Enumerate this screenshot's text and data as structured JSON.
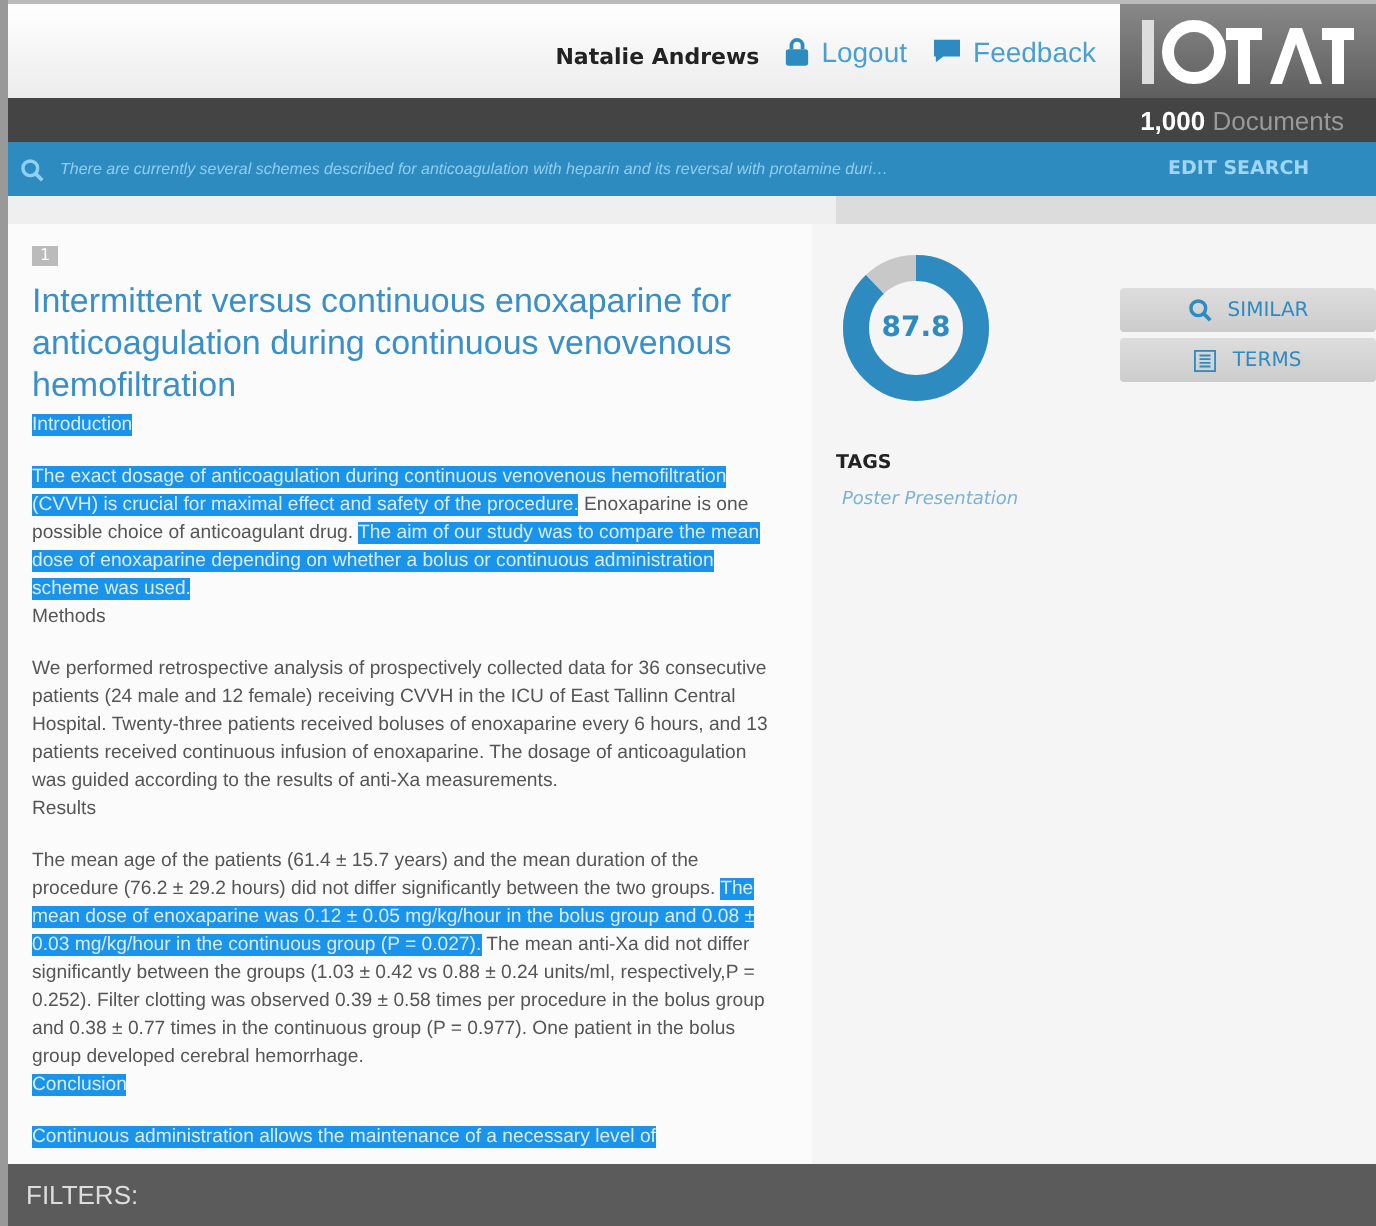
{
  "header": {
    "user": "Natalie Andrews",
    "logout": "Logout",
    "feedback": "Feedback"
  },
  "documents": {
    "count": "1,000",
    "label": "Documents"
  },
  "search": {
    "query": "There are currently several schemes described for anticoagulation with heparin and its reversal with protamine duri…",
    "edit": "EDIT SEARCH"
  },
  "result": {
    "number": "1",
    "title": "Intermittent versus continuous enoxaparine for anticoagulation during continuous venovenous hemofiltration",
    "blocks": [
      {
        "kind": "heading",
        "segments": [
          {
            "text": "Introduction",
            "highlighted": true
          }
        ]
      },
      {
        "kind": "paragraph",
        "segments": [
          {
            "text": "The exact dosage of anticoagulation during continuous venovenous hemofiltration (CVVH) is crucial for maximal effect and safety of the procedure.",
            "highlighted": true
          },
          {
            "text": " Enoxaparine is one possible choice of anticoagulant drug. ",
            "highlighted": false
          },
          {
            "text": "The aim of our study was to compare the mean dose of enoxaparine depending on whether a bolus or continuous administration scheme was used.",
            "highlighted": true
          }
        ]
      },
      {
        "kind": "heading",
        "segments": [
          {
            "text": "Methods",
            "highlighted": false
          }
        ]
      },
      {
        "kind": "paragraph",
        "segments": [
          {
            "text": "We performed retrospective analysis of prospectively collected data for 36 consecutive patients (24 male and 12 female) receiving CVVH in the ICU of East Tallinn Central Hospital. Twenty-three patients received boluses of enoxaparine every 6 hours, and 13 patients received continuous infusion of enoxaparine. The dosage of anticoagulation was guided according to the results of anti-Xa measurements.",
            "highlighted": false
          }
        ]
      },
      {
        "kind": "heading",
        "segments": [
          {
            "text": "Results",
            "highlighted": false
          }
        ]
      },
      {
        "kind": "paragraph",
        "segments": [
          {
            "text": "The mean age of the patients (61.4 ± 15.7 years) and the mean duration of the procedure (76.2 ± 29.2 hours) did not differ significantly between the two groups. ",
            "highlighted": false
          },
          {
            "text": "The mean dose of enoxaparine was 0.12 ± 0.05 mg/kg/hour in the bolus group and 0.08 ± 0.03 mg/kg/hour in the continuous group (P = 0.027).",
            "highlighted": true
          },
          {
            "text": " The mean anti-Xa did not differ significantly between the groups (1.03 ± 0.42 vs 0.88 ± 0.24 units/ml, respectively,P = 0.252). Filter clotting was observed 0.39 ± 0.58 times per procedure in the bolus group and 0.38 ± 0.77 times in the continuous group (P = 0.977). One patient in the bolus group developed cerebral hemorrhage.",
            "highlighted": false
          }
        ]
      },
      {
        "kind": "heading",
        "segments": [
          {
            "text": "Conclusion",
            "highlighted": true
          }
        ]
      },
      {
        "kind": "paragraph",
        "segments": [
          {
            "text": "Continuous administration allows the maintenance of a necessary level of",
            "highlighted": true
          }
        ]
      }
    ]
  },
  "score": {
    "value": "87.8",
    "level": 0.878
  },
  "tags": {
    "title": "TAGS",
    "items": [
      "Poster Presentation"
    ]
  },
  "actions": [
    {
      "kind": "similar",
      "label": "SIMILAR"
    },
    {
      "kind": "terms",
      "label": "TERMS"
    }
  ],
  "filters": {
    "label": "FILTERS:"
  }
}
